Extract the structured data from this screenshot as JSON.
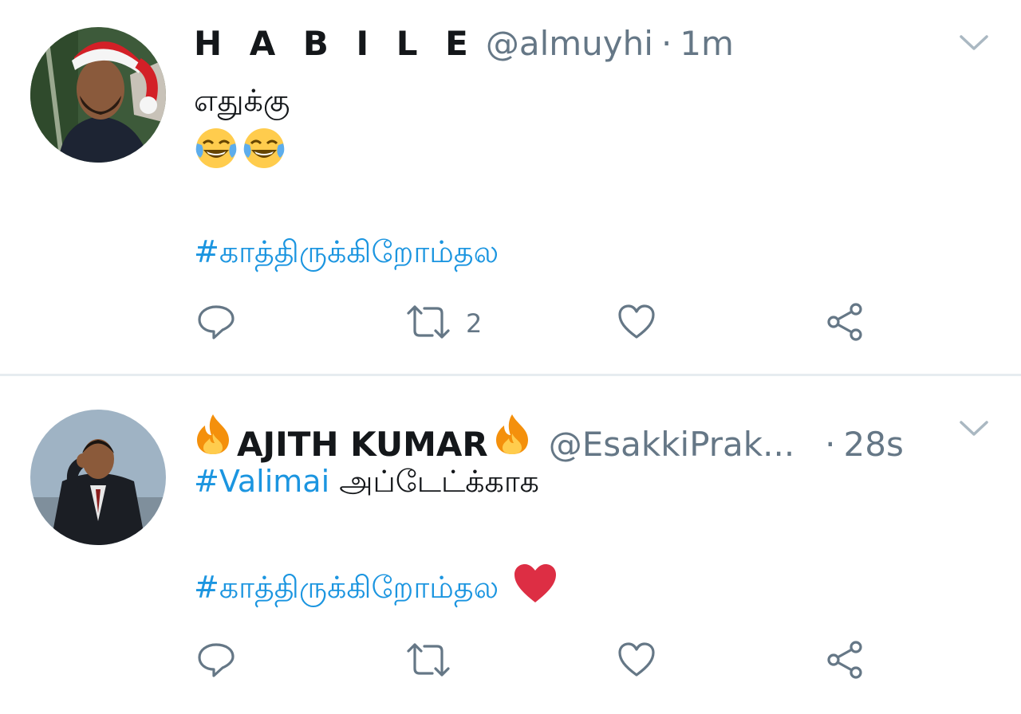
{
  "tweets": [
    {
      "name": "H A B I L E",
      "handle": "@almuyhi",
      "separator": "·",
      "time": "1m",
      "line1": "எதுக்கு",
      "emojis": [
        "face-with-tears-of-joy",
        "face-with-tears-of-joy"
      ],
      "hashtag": "#காத்திருக்கிறோம்தல",
      "actions": {
        "reply_count": "",
        "retweet_count": "2",
        "like_count": ""
      }
    },
    {
      "name": "AJITH KUMAR",
      "name_emojis": [
        "fire",
        "fire"
      ],
      "handle": "@EsakkiPrak...",
      "separator": "·",
      "time": "28s",
      "line1_hashtag": "#Valimai",
      "line1_text": " அப்டேட்க்காக",
      "hashtag": "#காத்திருக்கிறோம்தல",
      "trailing_emoji": "red-heart",
      "actions": {
        "reply_count": "",
        "retweet_count": "",
        "like_count": ""
      }
    }
  ],
  "colors": {
    "hashtag": "#1b95e0",
    "secondary": "#657786",
    "divider": "#e6ecf0",
    "heart": "#dd2e44"
  }
}
